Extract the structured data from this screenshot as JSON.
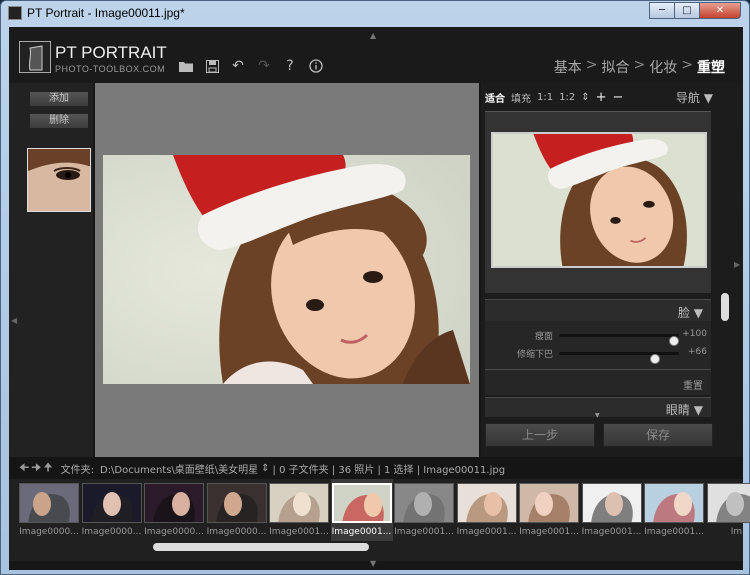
{
  "window": {
    "title": "PT Portrait - Image00011.jpg*",
    "min_icon": "minimize-icon",
    "max_icon": "maximize-icon",
    "close_icon": "close-icon"
  },
  "header": {
    "logo_title": "PT PORTRAIT",
    "logo_sub": "PHOTO-TOOLBOX.COM",
    "toolbar_icons": [
      "folder-icon",
      "save-icon",
      "undo-icon",
      "redo-icon",
      "help-icon",
      "info-icon"
    ],
    "breadcrumb": [
      "基本",
      ">",
      "拟合",
      ">",
      "化妆",
      ">",
      "重塑"
    ],
    "active_step": "重塑"
  },
  "left_panel": {
    "add_label": "添加",
    "delete_label": "删除"
  },
  "navigator": {
    "fit": "适合",
    "fill": "填充",
    "one_to_one": "1:1",
    "one_to_two": "1:2",
    "title": "导航"
  },
  "face_section": {
    "title": "脸",
    "sliders": [
      {
        "label": "瘦面",
        "value": "+100",
        "level": 1.0
      },
      {
        "label": "修缩下巴",
        "value": "+66",
        "level": 0.83
      }
    ],
    "reset_label": "重置"
  },
  "eyes_section": {
    "title": "眼睛"
  },
  "actions": {
    "prev_label": "上一步",
    "save_label": "保存"
  },
  "filebar": {
    "folder_label": "文件夹:",
    "path": "D:\\Documents\\桌面壁纸\\美女明星",
    "info": "| 0 子文件夹 | 36 照片 | 1 选择 | Image00011.jpg"
  },
  "filmstrip": {
    "items": [
      "Image0000...",
      "Image0000...",
      "Image0000...",
      "Image0000...",
      "Image0001...",
      "Image0001...",
      "Image0001...",
      "Image0001...",
      "Image0001...",
      "Image0001...",
      "Image0001...",
      "Im"
    ],
    "selected_index": 5
  },
  "colors": {
    "app_bg": "#161616",
    "panel_bg": "#222222",
    "canvas_bg": "#7a7a7a",
    "accent_white": "#ffffff"
  }
}
